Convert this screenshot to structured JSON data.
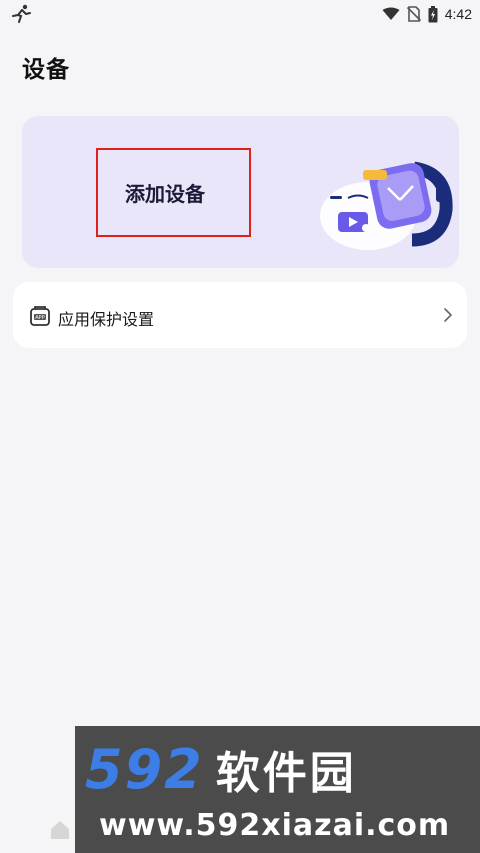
{
  "status_bar": {
    "time": "4:42",
    "icons": [
      "activity-icon",
      "wifi-icon",
      "no-sim-icon",
      "battery-charging-icon"
    ]
  },
  "page": {
    "title": "设备"
  },
  "add_device_card": {
    "label": "添加设备",
    "illustration": "smartwatch-illustration",
    "highlight_color": "#e0201d",
    "background": "#e8e6f8"
  },
  "app_protect": {
    "icon": "app-icon",
    "label": "应用保护设置",
    "chevron": "chevron-right-icon"
  },
  "bottom_nav": {
    "icons": [
      "home-icon"
    ]
  },
  "watermark": {
    "brand_number": "592",
    "brand_name": "软件园",
    "url": "www.592xiazai.com",
    "number_color": "#3d7de6"
  }
}
